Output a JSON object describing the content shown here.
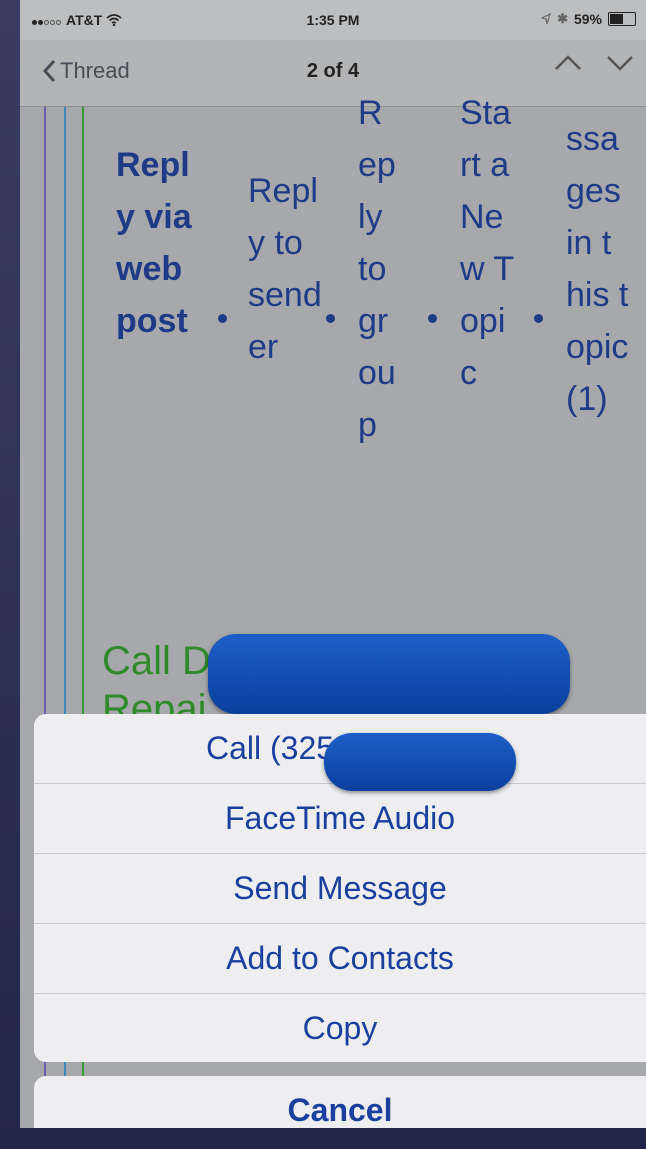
{
  "status_bar": {
    "carrier": "AT&T",
    "time": "1:35 PM",
    "battery": "59%",
    "battery_level": 0.59
  },
  "nav": {
    "back_label": "Thread",
    "title": "2 of 4"
  },
  "content": {
    "link_reply_web": "Reply via web post",
    "link_reply_sender": "Reply to sender",
    "link_reply_group": "Reply to group",
    "link_new_topic": "Start a New Topic",
    "link_messages": "ssages in this topic (1)",
    "call_text": "Call D",
    "repair_text": "Repai"
  },
  "action_sheet": {
    "items": [
      {
        "label": "Call (325"
      },
      {
        "label": "FaceTime Audio"
      },
      {
        "label": "Send Message"
      },
      {
        "label": "Add to Contacts"
      },
      {
        "label": "Copy"
      }
    ],
    "cancel": "Cancel"
  },
  "colors": {
    "link_blue": "#1f3a86",
    "call_green": "#2f8a2b",
    "sheet_blue": "#1a3f9e",
    "redaction": "#0b4fb3"
  }
}
